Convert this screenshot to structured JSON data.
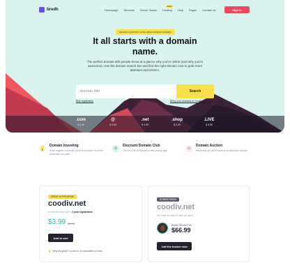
{
  "brand": {
    "name": "bredh",
    "accent": "#f0475a",
    "yellow": "#f7e04a",
    "teal": "#2bb5a8"
  },
  "nav": {
    "items": [
      "Homepage",
      "Services",
      "Server Status",
      "Hosting",
      "Help",
      "Pages",
      "Contact us"
    ],
    "badge": "New",
    "signin": "Sign In"
  },
  "hero": {
    "pill": "SEARCH AND BUY AVAILABLE DOMAIN NAMES",
    "headline": "It all starts with a domain name.",
    "subtext": "The perfect domain tells people know at a glance why you're online (and why you're awesome). Use the domain search bar and find the right domain now to grab more attention and visitors.",
    "search_placeholder": "domain.info",
    "search_button": "Search",
    "bulk_link": "Bulk registration",
    "bring_link": "Bring your domains to Coodiv.host"
  },
  "tlds": [
    {
      "name": ".com",
      "price": "$ 3.99"
    },
    {
      "name": "@",
      "price": "$ 3.99"
    },
    {
      "name": ".net",
      "price": "$ 3.99"
    },
    {
      "name": ".shop",
      "price": "$ 3.99"
    },
    {
      "name": ".LIVE",
      "price": "$ 3.99"
    }
  ],
  "features": [
    {
      "title": "Domain Investing",
      "desc": "If you register a domain name and believe it's worth more than you paid",
      "icon": "lightbulb-icon",
      "color": "#fdf3c4"
    },
    {
      "title": "Discount Domain Club",
      "desc": "Get the thrill of buying low and selling high.",
      "icon": "smiley-icon",
      "color": "#d4f1ec"
    },
    {
      "title": "Domain Auction",
      "desc": "When you get your hands on a distinctive domain",
      "icon": "sun-icon",
      "color": "#fde7ea"
    }
  ],
  "card_left": {
    "badge": "GREAT ALTERNATIVE",
    "domain": "coodiv.net",
    "first_year_prefix": "for the first year with a",
    "first_year_bold": "2 year registration",
    "price": "$3.99",
    "old_price": "$8.99",
    "button": "Add to cart",
    "why": "Why it's great? coodiv is 15 characters or less."
  },
  "card_right": {
    "badge": "DOMAIN TAKEN",
    "domain": "coodiv.net",
    "sub": "We might be able to help you get it.",
    "broker_label": "Broker Service Fee",
    "broker_price": "$66.99",
    "button": "Call the broker now"
  }
}
